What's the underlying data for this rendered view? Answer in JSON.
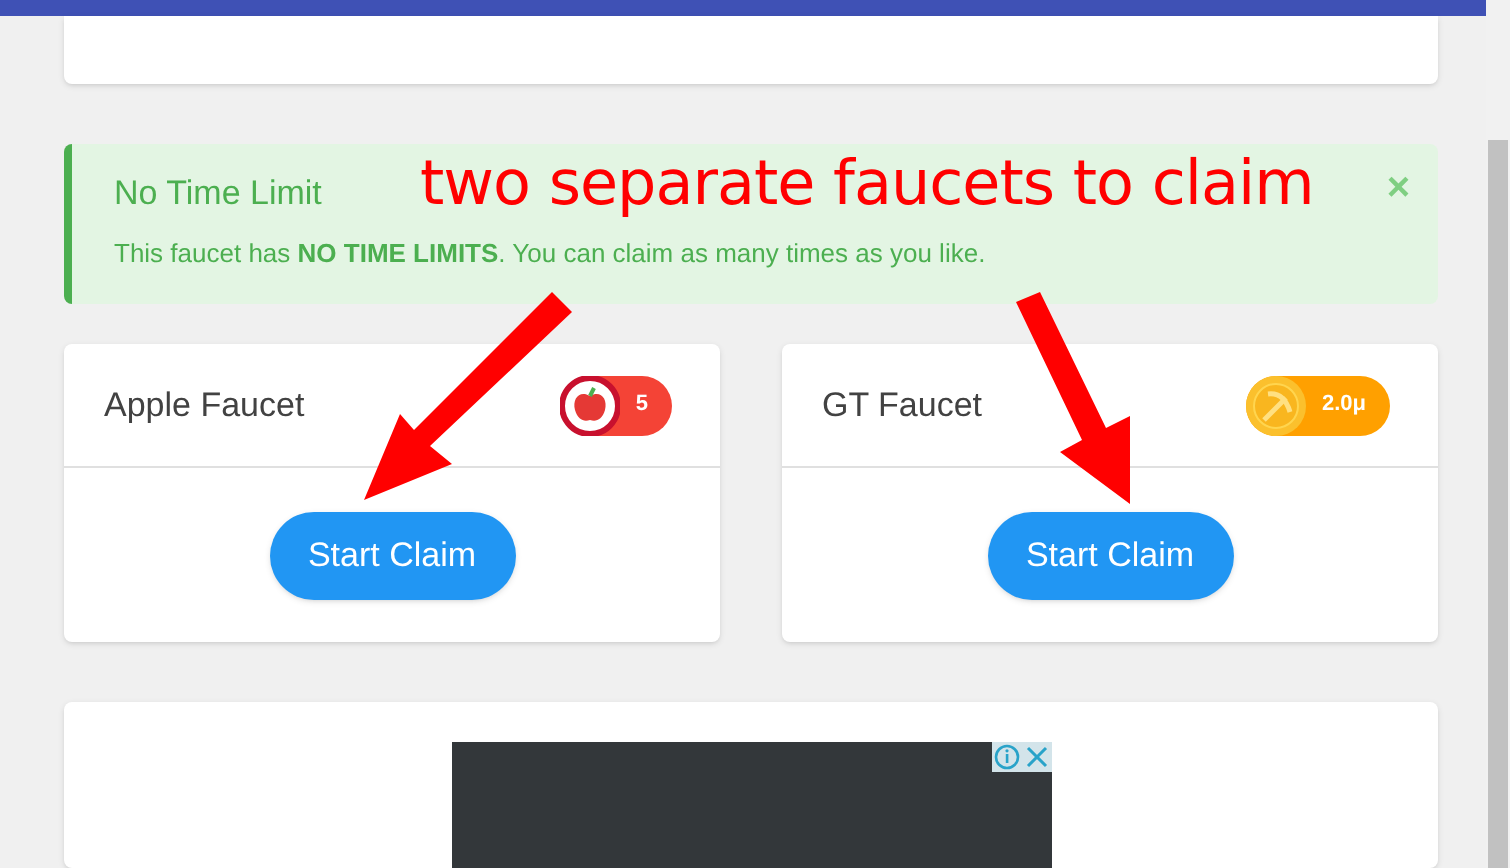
{
  "alert": {
    "title": "No Time Limit",
    "message": "This faucet has **NO TIME LIMITS**. You can claim as many times as you like.",
    "close": "×"
  },
  "annotation": {
    "text": "two separate faucets to claim"
  },
  "faucets": [
    {
      "name": "Apple Faucet",
      "badge": "5",
      "kind": "apple",
      "color": "#f44336",
      "button": "Start Claim"
    },
    {
      "name": "GT Faucet",
      "badge": "2.0μ",
      "kind": "pickaxe",
      "color": "#ffa000",
      "button": "Start Claim"
    }
  ]
}
